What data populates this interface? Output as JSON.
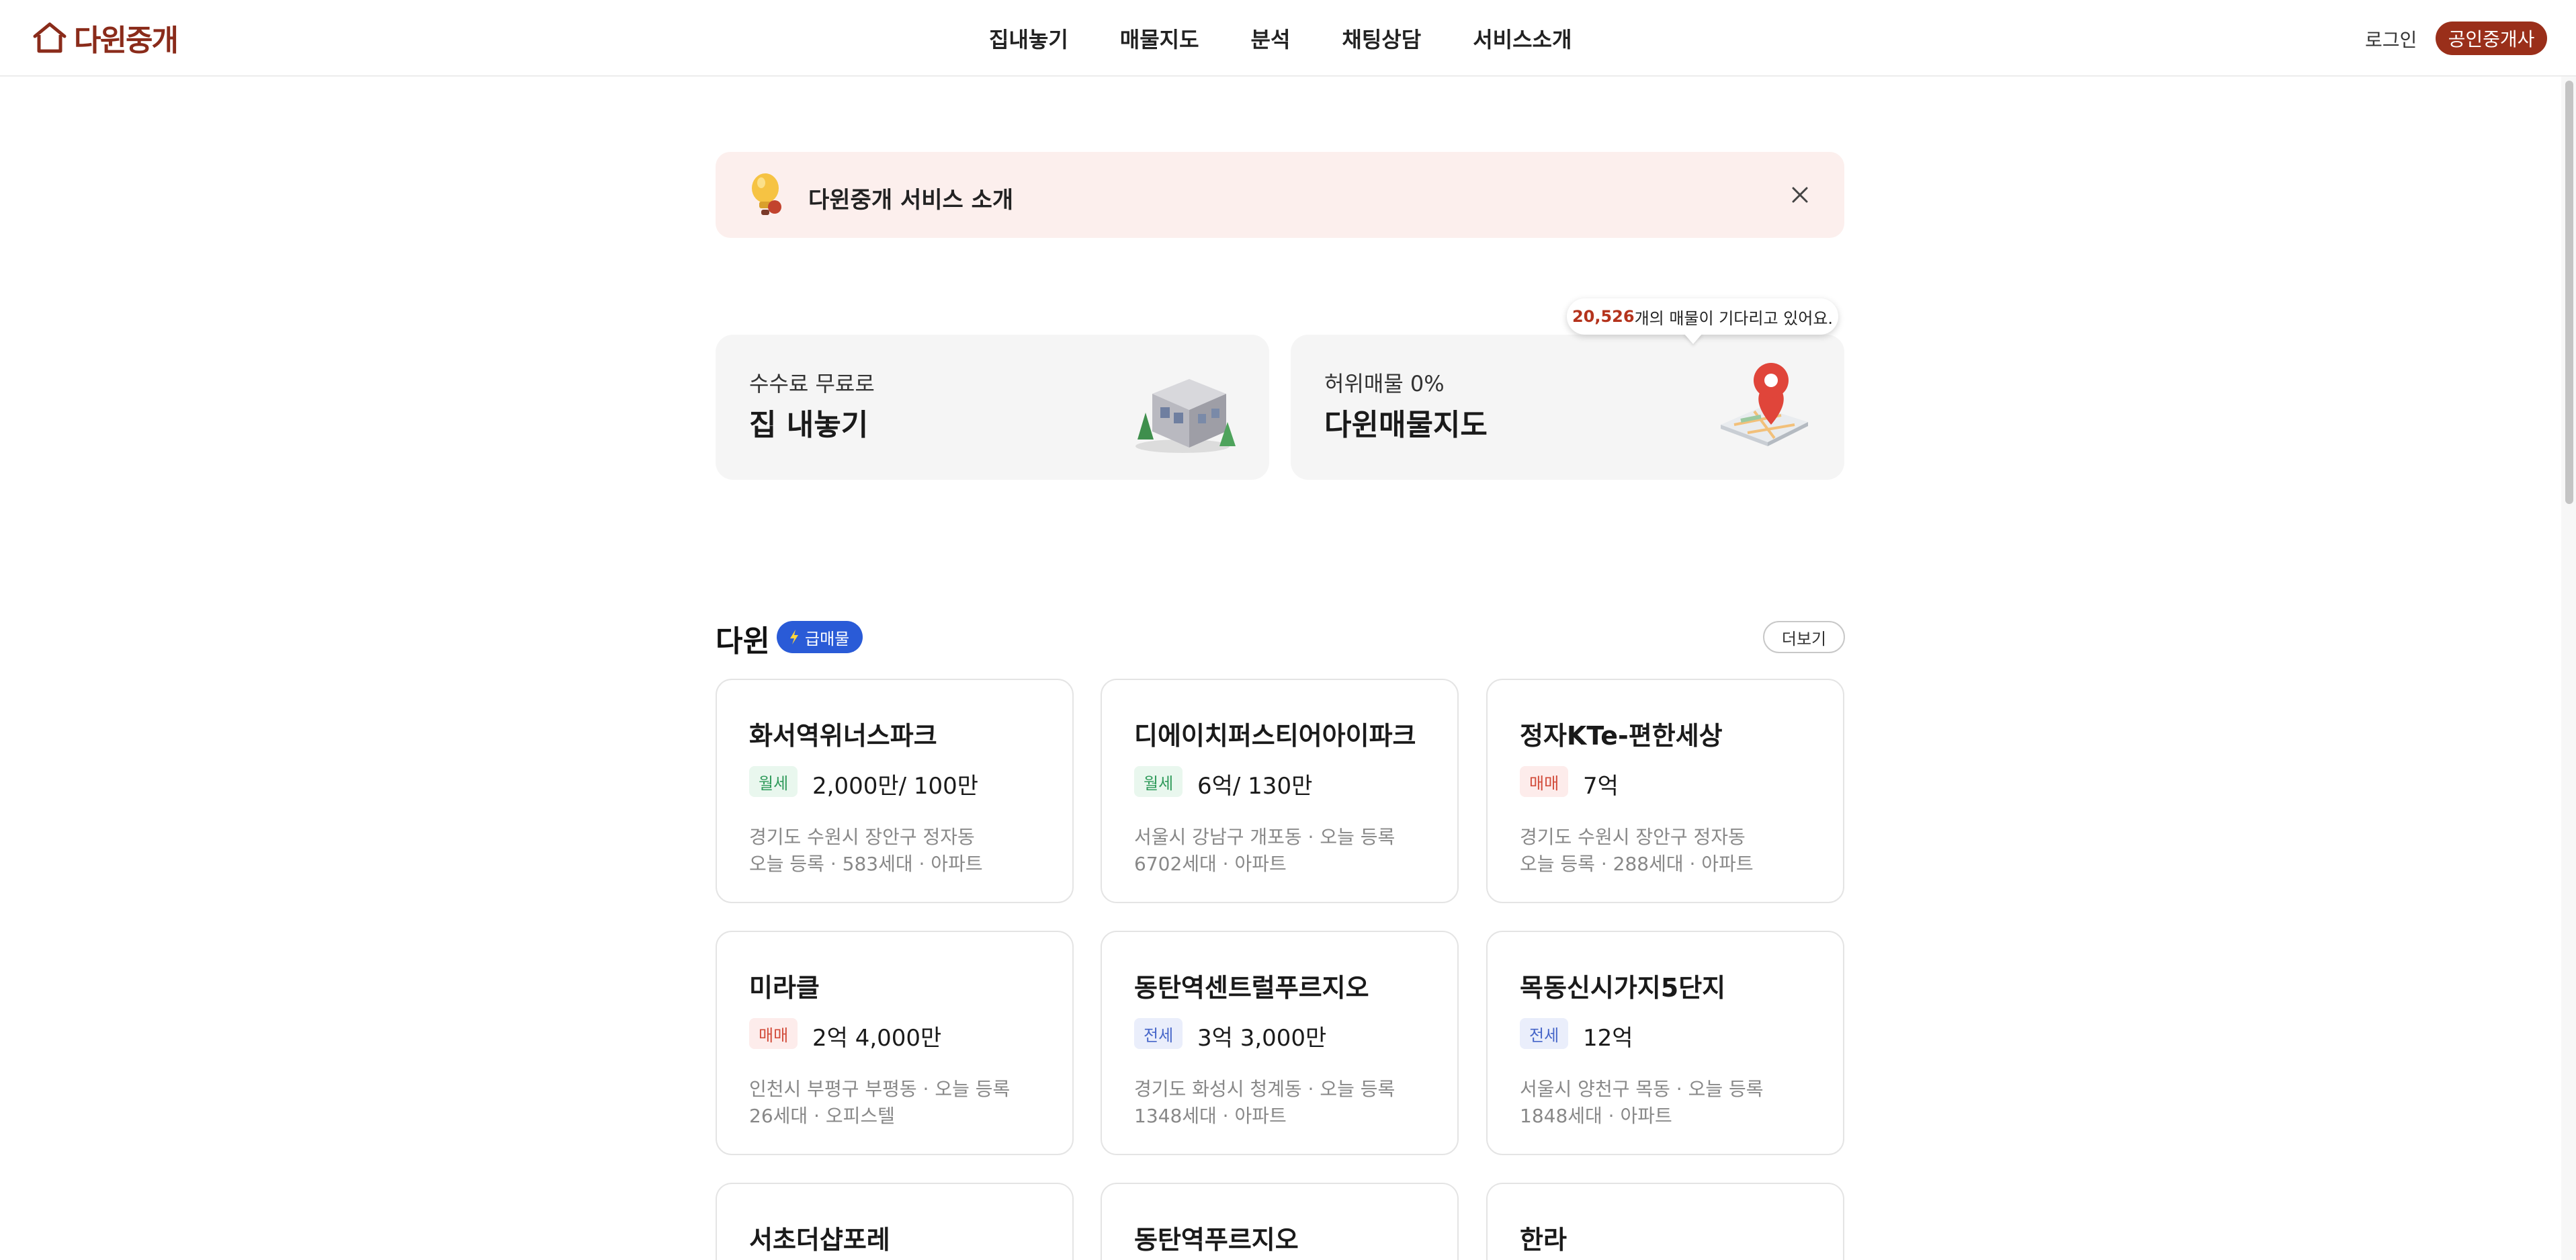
{
  "header": {
    "logo_text": "다윈중개",
    "nav": [
      "집내놓기",
      "매물지도",
      "분석",
      "채팅상담",
      "서비스소개"
    ],
    "login_label": "로그인",
    "agent_button_label": "공인중개사"
  },
  "banner": {
    "text": "다윈중개 서비스 소개"
  },
  "hero": {
    "left": {
      "subtitle": "수수료 무료로",
      "title": "집 내놓기"
    },
    "right": {
      "subtitle": "허위매물 0%",
      "title": "다윈매물지도"
    },
    "tooltip": {
      "count": "20,526",
      "suffix": "개의 매물이 기다리고 있어요."
    }
  },
  "section": {
    "title": "다윈",
    "badge": "급매물",
    "more_label": "더보기"
  },
  "listings": [
    {
      "name": "화서역위너스파크",
      "deal": "월세",
      "price": "2,000만/ 100만",
      "line1": "경기도 수원시 장안구 정자동",
      "line2": "오늘 등록 · 583세대 · 아파트"
    },
    {
      "name": "디에이치퍼스티어아이파크",
      "deal": "월세",
      "price": "6억/ 130만",
      "line1": "서울시 강남구 개포동 · 오늘 등록",
      "line2": "6702세대 · 아파트"
    },
    {
      "name": "정자KTe-편한세상",
      "deal": "매매",
      "price": "7억",
      "line1": "경기도 수원시 장안구 정자동",
      "line2": "오늘 등록 · 288세대 · 아파트"
    },
    {
      "name": "미라클",
      "deal": "매매",
      "price": "2억 4,000만",
      "line1": "인천시 부평구 부평동 · 오늘 등록",
      "line2": "26세대 · 오피스텔"
    },
    {
      "name": "동탄역센트럴푸르지오",
      "deal": "전세",
      "price": "3억 3,000만",
      "line1": "경기도 화성시 청계동 · 오늘 등록",
      "line2": "1348세대 · 아파트"
    },
    {
      "name": "목동신시가지5단지",
      "deal": "전세",
      "price": "12억",
      "line1": "서울시 양천구 목동 · 오늘 등록",
      "line2": "1848세대 · 아파트"
    },
    {
      "name": "서초더샵포레",
      "deal": "",
      "price": "",
      "line1": "",
      "line2": ""
    },
    {
      "name": "동탄역푸르지오",
      "deal": "",
      "price": "",
      "line1": "",
      "line2": ""
    },
    {
      "name": "한라",
      "deal": "",
      "price": "",
      "line1": "",
      "line2": ""
    }
  ],
  "colors": {
    "brand": "#9a2f1a",
    "banner_bg": "#fcefed",
    "badge_blue": "#2a5bd7"
  }
}
